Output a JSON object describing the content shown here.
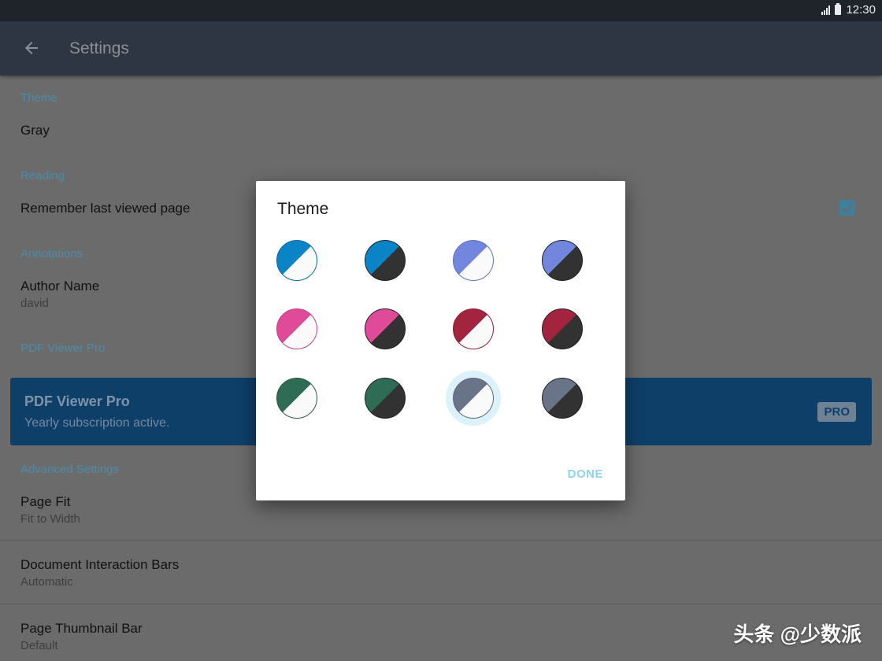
{
  "status_bar": {
    "time": "12:30"
  },
  "app_bar": {
    "title": "Settings"
  },
  "settings": {
    "theme": {
      "header": "Theme",
      "value": "Gray"
    },
    "reading": {
      "header": "Reading",
      "remember_last_page": "Remember last viewed page",
      "remember_checked": true
    },
    "annotations": {
      "header": "Annotations",
      "author_name_label": "Author Name",
      "author_name_value": "david"
    },
    "pdf_viewer_pro": {
      "header": "PDF Viewer Pro",
      "card_title": "PDF Viewer Pro",
      "card_subtitle": "Yearly subscription active.",
      "badge": "PRO"
    },
    "advanced": {
      "header": "Advanced Settings",
      "page_fit_label": "Page Fit",
      "page_fit_value": "Fit to Width",
      "interaction_bars_label": "Document Interaction Bars",
      "interaction_bars_value": "Automatic",
      "thumbnail_bar_label": "Page Thumbnail Bar",
      "thumbnail_bar_value": "Default"
    }
  },
  "theme_dialog": {
    "title": "Theme",
    "done_label": "DONE",
    "swatches": [
      {
        "name": "blue-light",
        "primary": "#0a84c6",
        "secondary": "#fafafa",
        "ring": "#0a6a9c"
      },
      {
        "name": "blue-dark",
        "primary": "#0a84c6",
        "secondary": "#323232",
        "ring": "#222222"
      },
      {
        "name": "periwinkle-light",
        "primary": "#7186dc",
        "secondary": "#fafafa",
        "ring": "#6073c0"
      },
      {
        "name": "periwinkle-dark",
        "primary": "#7186dc",
        "secondary": "#323232",
        "ring": "#222222"
      },
      {
        "name": "pink-light",
        "primary": "#df4a99",
        "secondary": "#fafafa",
        "ring": "#c13f84"
      },
      {
        "name": "pink-dark",
        "primary": "#df4a99",
        "secondary": "#323232",
        "ring": "#222222"
      },
      {
        "name": "crimson-light",
        "primary": "#a2243e",
        "secondary": "#fafafa",
        "ring": "#8e1f37"
      },
      {
        "name": "crimson-dark",
        "primary": "#a2243e",
        "secondary": "#323232",
        "ring": "#222222"
      },
      {
        "name": "green-light",
        "primary": "#2f6c55",
        "secondary": "#fafafa",
        "ring": "#285c48"
      },
      {
        "name": "green-dark",
        "primary": "#2f6c55",
        "secondary": "#323232",
        "ring": "#222222"
      },
      {
        "name": "gray-light",
        "primary": "#6a7488",
        "secondary": "#fafafa",
        "ring": "#5f6779",
        "selected": true
      },
      {
        "name": "gray-dark",
        "primary": "#6a7488",
        "secondary": "#323232",
        "ring": "#222222"
      }
    ]
  },
  "watermark": "头条 @少数派"
}
